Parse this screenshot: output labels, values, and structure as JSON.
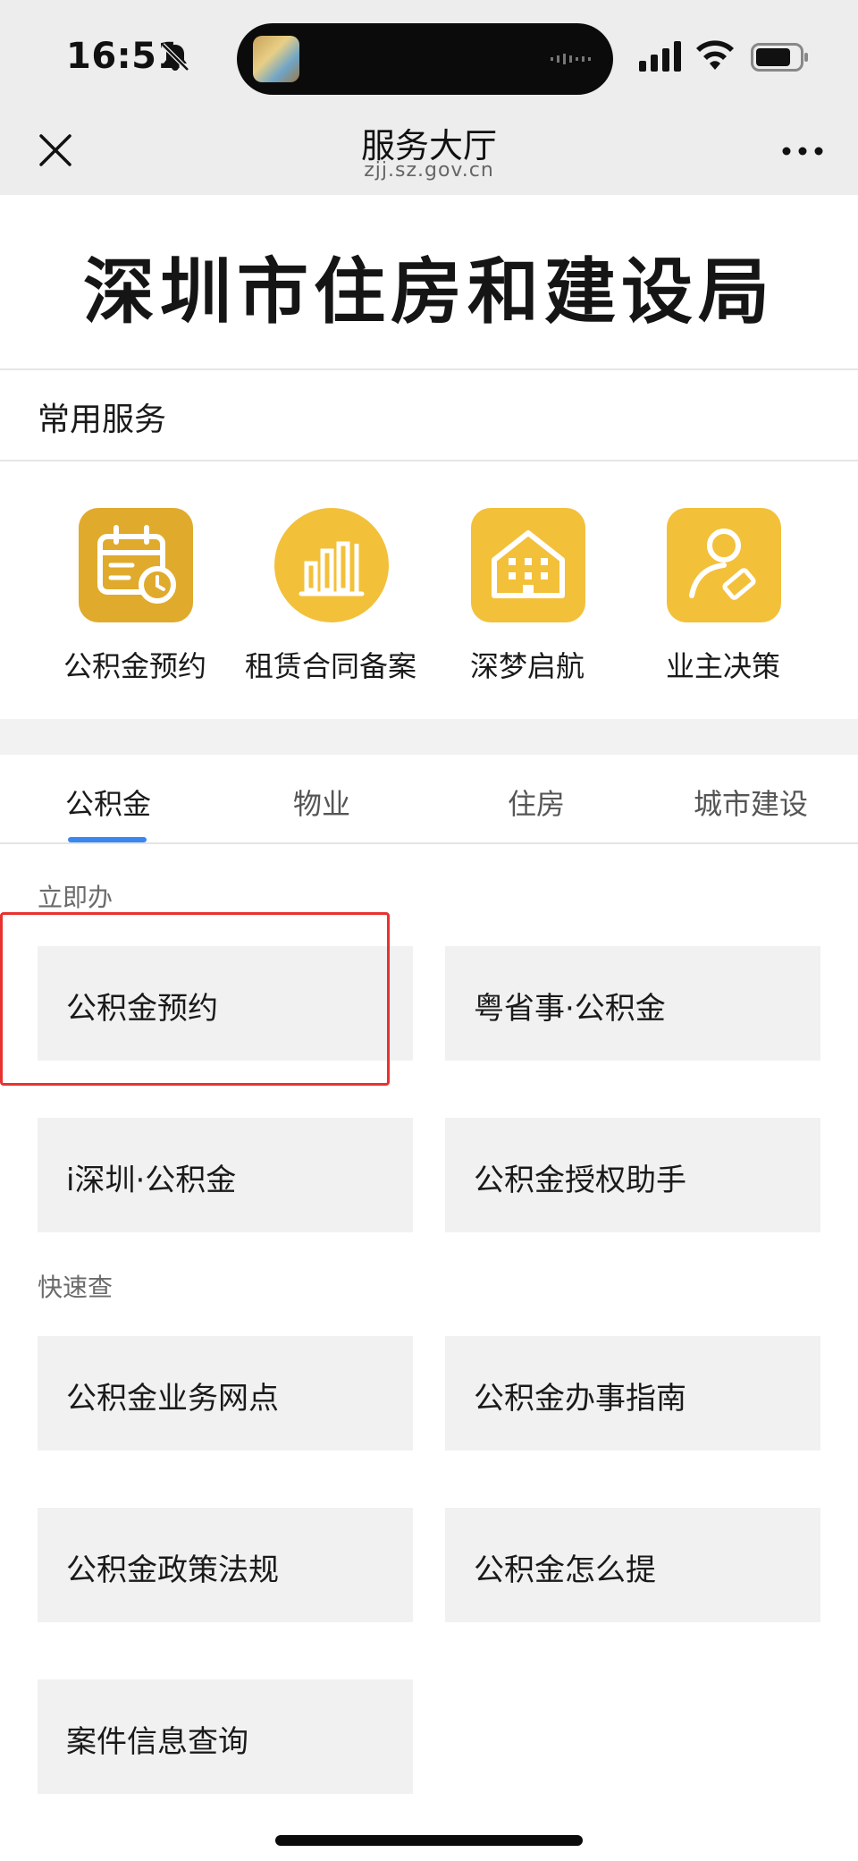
{
  "status_bar": {
    "time": "16:51",
    "icons": [
      "bell-off-icon",
      "cellular-signal-icon",
      "wifi-icon",
      "battery-icon"
    ]
  },
  "nav": {
    "title": "服务大厅",
    "url": "zjj.sz.gov.cn",
    "icons": [
      "close-icon",
      "more-icon"
    ]
  },
  "banner": {
    "title": "深圳市住房和建设局"
  },
  "common_services": {
    "heading": "常用服务",
    "items": [
      {
        "label": "公积金预约",
        "icon": "calendar-clock-icon"
      },
      {
        "label": "租赁合同备案",
        "icon": "bar-chart-icon"
      },
      {
        "label": "深梦启航",
        "icon": "building-icon"
      },
      {
        "label": "业主决策",
        "icon": "user-ticket-icon"
      }
    ]
  },
  "tabs": {
    "items": [
      {
        "label": "公积金",
        "active": true
      },
      {
        "label": "物业",
        "active": false
      },
      {
        "label": "住房",
        "active": false
      },
      {
        "label": "城市建设",
        "active": false
      }
    ]
  },
  "groups": [
    {
      "label": "立即办",
      "items": [
        "公积金预约",
        "粤省事·公积金",
        "i深圳·公积金",
        "公积金授权助手"
      ]
    },
    {
      "label": "快速查",
      "items": [
        "公积金业务网点",
        "公积金办事指南",
        "公积金政策法规",
        "公积金怎么提",
        "案件信息查询"
      ]
    }
  ],
  "colors": {
    "accent": "#3b87f0",
    "service_icon": "#f3c03a",
    "highlight": "#e8322f",
    "card_bg": "#f1f1f1"
  }
}
